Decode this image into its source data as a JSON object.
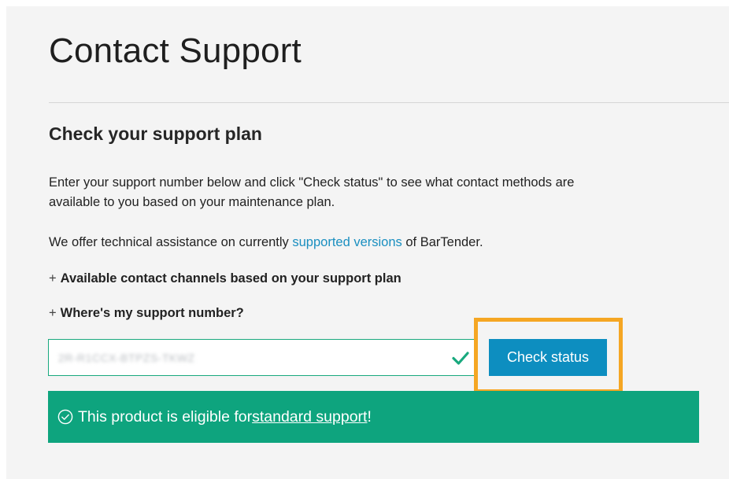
{
  "page": {
    "title": "Contact Support"
  },
  "section": {
    "title": "Check your support plan",
    "intro": "Enter your support number below and click \"Check status\" to see what contact methods are available to you based on your maintenance plan.",
    "offer_prefix": "We offer technical assistance on currently ",
    "offer_link": "supported versions",
    "offer_suffix": " of BarTender."
  },
  "expanders": [
    {
      "icon": "+",
      "label": "Available contact channels based on your support plan"
    },
    {
      "icon": "+",
      "label": "Where's my support number?"
    }
  ],
  "support_number": {
    "value": "2R-R1CCX-BTPZS-TKWZ",
    "valid_icon": "checkmark-icon"
  },
  "check_button": {
    "label": "Check status"
  },
  "banner": {
    "icon": "circle-check-icon",
    "prefix": "This product is eligible for ",
    "link": "standard support",
    "suffix": "!"
  },
  "colors": {
    "accent_blue": "#0d8ec0",
    "link_blue": "#1a8fc0",
    "success_green": "#0ea47e",
    "highlight_orange": "#f5a623"
  }
}
